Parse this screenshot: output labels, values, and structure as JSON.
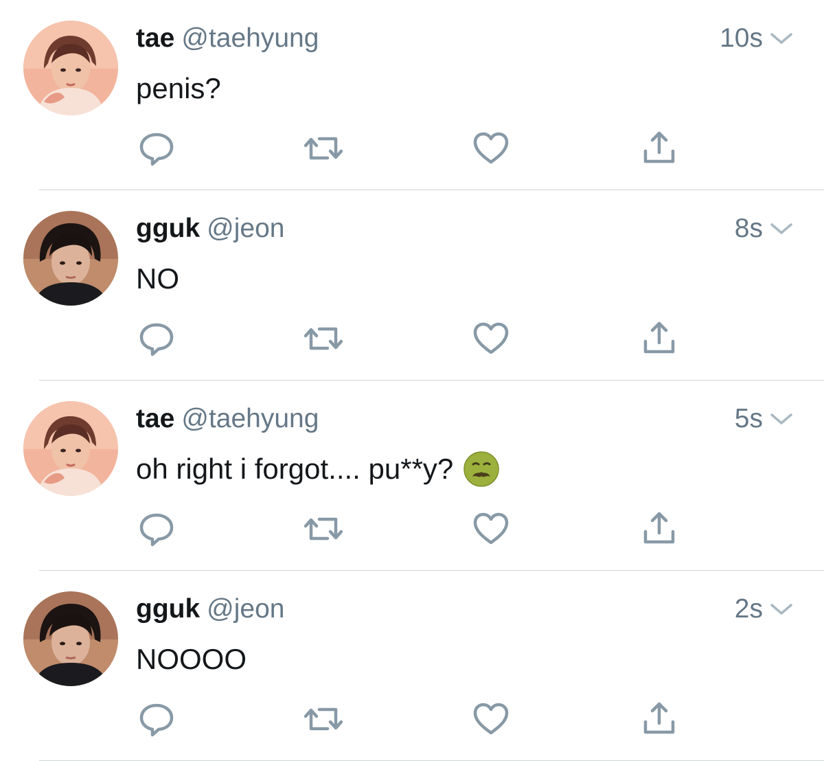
{
  "colors": {
    "name": "#14171a",
    "muted": "#657786",
    "icon": "#8899a6",
    "divider": "#cfd5da",
    "background": "#ffffff"
  },
  "tweets": [
    {
      "display_name": "tae",
      "handle": "@taehyung",
      "time": "10s",
      "text": "penis?",
      "emoji": null,
      "avatar": "avatar-tae"
    },
    {
      "display_name": "gguk",
      "handle": "@jeon",
      "time": "8s",
      "text": "NO",
      "emoji": null,
      "avatar": "avatar-gguk"
    },
    {
      "display_name": "tae",
      "handle": "@taehyung",
      "time": "5s",
      "text": "oh right i forgot.... pu**y?",
      "emoji": "nauseated-face-icon",
      "avatar": "avatar-tae"
    },
    {
      "display_name": "gguk",
      "handle": "@jeon",
      "time": "2s",
      "text": "NOOOO",
      "emoji": null,
      "avatar": "avatar-gguk"
    }
  ],
  "actions": [
    "reply-icon",
    "retweet-icon",
    "like-icon",
    "share-icon"
  ]
}
